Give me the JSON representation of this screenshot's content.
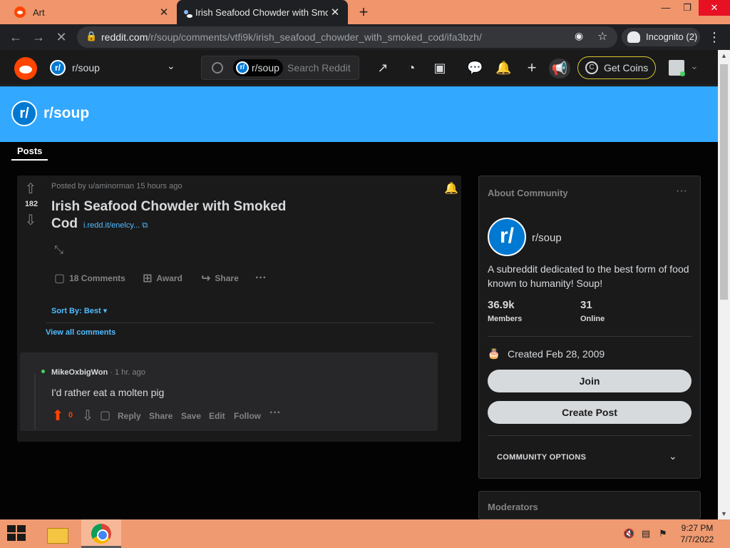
{
  "browser": {
    "tabs": [
      {
        "title": "Art"
      },
      {
        "title": "Irish Seafood Chowder with Smoked Cod"
      }
    ],
    "url_host": "reddit.com",
    "url_path": "/r/soup/comments/vtfi9k/irish_seafood_chowder_with_smoked_cod/ifa3bzh/",
    "incognito_label": "Incognito (2)"
  },
  "header": {
    "community": "r/soup",
    "search_chip": "r/soup",
    "search_placeholder": "Search Reddit",
    "get_coins": "Get Coins"
  },
  "banner": {
    "title": "r/soup",
    "tab_posts": "Posts"
  },
  "post": {
    "votes": "182",
    "meta": "Posted by u/aminorman 15 hours ago",
    "title": "Irish Seafood Chowder with Smoked Cod",
    "link": "i.redd.it/enelcy...",
    "actions": {
      "comments": "18 Comments",
      "award": "Award",
      "share": "Share"
    },
    "sort_by": "Sort By: Best",
    "view_all": "View all comments"
  },
  "comment": {
    "author": "MikeOxbigWon",
    "time": "· 1 hr. ago",
    "body": "I'd rather eat a molten pig",
    "votes": "0",
    "actions": {
      "reply": "Reply",
      "share": "Share",
      "save": "Save",
      "edit": "Edit",
      "follow": "Follow"
    }
  },
  "sidebar": {
    "about_title": "About Community",
    "name": "r/soup",
    "description": "A subreddit dedicated to the best form of food known to humanity! Soup!",
    "members_value": "36.9k",
    "members_label": "Members",
    "online_value": "31",
    "online_label": "Online",
    "created": "Created Feb 28, 2009",
    "join": "Join",
    "create_post": "Create Post",
    "community_options": "COMMUNITY OPTIONS",
    "moderators_title": "Moderators"
  },
  "taskbar": {
    "time": "9:27 PM",
    "date": "7/7/2022"
  },
  "colors": {
    "reddit_orange": "#ff4500",
    "banner_blue": "#33a8ff",
    "link_blue": "#4fbcff",
    "card_bg": "#1a1a1b",
    "page_bg": "#030303"
  }
}
